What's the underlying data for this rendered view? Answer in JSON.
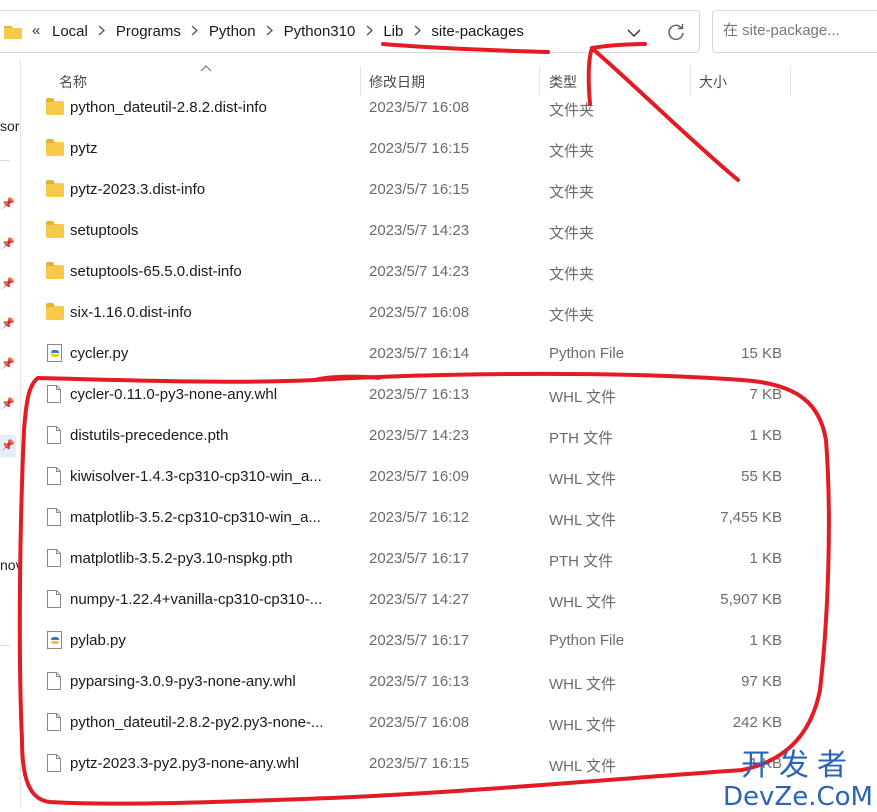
{
  "address_bar": {
    "overflow_glyph": "«",
    "breadcrumbs": [
      "Local",
      "Programs",
      "Python",
      "Python310",
      "Lib",
      "site-packages"
    ],
    "dropdown_icon": "chevron-down-icon",
    "refresh_icon": "refresh-icon"
  },
  "search": {
    "placeholder": "在 site-package..."
  },
  "sidebar": {
    "partial_labels": [
      "sor",
      "nov"
    ]
  },
  "columns": {
    "name": "名称",
    "date": "修改日期",
    "type": "类型",
    "size": "大小"
  },
  "files": [
    {
      "name": "python_dateutil-2.8.2.dist-info",
      "date": "2023/5/7 16:08",
      "type": "文件夹",
      "size": "",
      "icon": "folder"
    },
    {
      "name": "pytz",
      "date": "2023/5/7 16:15",
      "type": "文件夹",
      "size": "",
      "icon": "folder"
    },
    {
      "name": "pytz-2023.3.dist-info",
      "date": "2023/5/7 16:15",
      "type": "文件夹",
      "size": "",
      "icon": "folder"
    },
    {
      "name": "setuptools",
      "date": "2023/5/7 14:23",
      "type": "文件夹",
      "size": "",
      "icon": "folder"
    },
    {
      "name": "setuptools-65.5.0.dist-info",
      "date": "2023/5/7 14:23",
      "type": "文件夹",
      "size": "",
      "icon": "folder"
    },
    {
      "name": "six-1.16.0.dist-info",
      "date": "2023/5/7 16:08",
      "type": "文件夹",
      "size": "",
      "icon": "folder"
    },
    {
      "name": "cycler.py",
      "date": "2023/5/7 16:14",
      "type": "Python File",
      "size": "15 KB",
      "icon": "python"
    },
    {
      "name": "cycler-0.11.0-py3-none-any.whl",
      "date": "2023/5/7 16:13",
      "type": "WHL 文件",
      "size": "7 KB",
      "icon": "file"
    },
    {
      "name": "distutils-precedence.pth",
      "date": "2023/5/7 14:23",
      "type": "PTH 文件",
      "size": "1 KB",
      "icon": "file"
    },
    {
      "name": "kiwisolver-1.4.3-cp310-cp310-win_a...",
      "date": "2023/5/7 16:09",
      "type": "WHL 文件",
      "size": "55 KB",
      "icon": "file"
    },
    {
      "name": "matplotlib-3.5.2-cp310-cp310-win_a...",
      "date": "2023/5/7 16:12",
      "type": "WHL 文件",
      "size": "7,455 KB",
      "icon": "file"
    },
    {
      "name": "matplotlib-3.5.2-py3.10-nspkg.pth",
      "date": "2023/5/7 16:17",
      "type": "PTH 文件",
      "size": "1 KB",
      "icon": "file"
    },
    {
      "name": "numpy-1.22.4+vanilla-cp310-cp310-...",
      "date": "2023/5/7 14:27",
      "type": "WHL 文件",
      "size": "5,907 KB",
      "icon": "file"
    },
    {
      "name": "pylab.py",
      "date": "2023/5/7 16:17",
      "type": "Python File",
      "size": "1 KB",
      "icon": "python"
    },
    {
      "name": "pyparsing-3.0.9-py3-none-any.whl",
      "date": "2023/5/7 16:13",
      "type": "WHL 文件",
      "size": "97 KB",
      "icon": "file"
    },
    {
      "name": "python_dateutil-2.8.2-py2.py3-none-...",
      "date": "2023/5/7 16:08",
      "type": "WHL 文件",
      "size": "242 KB",
      "icon": "file"
    },
    {
      "name": "pytz-2023.3-py2.py3-none-any.whl",
      "date": "2023/5/7 16:15",
      "type": "WHL 文件",
      "size": "1 KB",
      "icon": "file"
    }
  ],
  "watermark": {
    "line1": "开发者",
    "line2": "DevZe.CoM"
  },
  "colors": {
    "annotation": "#e41b23",
    "folder": "#f7c948",
    "watermark": "#2b63b8"
  }
}
